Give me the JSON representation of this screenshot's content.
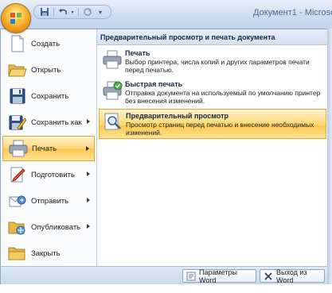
{
  "window": {
    "title": "Документ1 - Microsof"
  },
  "quick_access": {
    "items": [
      {
        "icon": "save-icon"
      },
      {
        "icon": "undo-icon"
      },
      {
        "icon": "redo-icon"
      },
      {
        "icon": "customize-qat-icon"
      }
    ]
  },
  "office_button": {
    "icon": "office-logo-icon"
  },
  "menu": {
    "items": [
      {
        "label": "Создать",
        "icon": "new-document-icon",
        "submenu": false
      },
      {
        "label": "Открыть",
        "icon": "open-folder-icon",
        "submenu": false
      },
      {
        "label": "Сохранить",
        "icon": "save-icon",
        "submenu": false
      },
      {
        "label": "Сохранить как",
        "icon": "save-as-icon",
        "submenu": true
      },
      {
        "label": "Печать",
        "icon": "print-icon",
        "submenu": true,
        "selected": true
      },
      {
        "label": "Подготовить",
        "icon": "prepare-icon",
        "submenu": true
      },
      {
        "label": "Отправить",
        "icon": "send-icon",
        "submenu": true
      },
      {
        "label": "Опубликовать",
        "icon": "publish-icon",
        "submenu": true
      },
      {
        "label": "Закрыть",
        "icon": "close-folder-icon",
        "submenu": false
      }
    ]
  },
  "submenu": {
    "header": "Предварительный просмотр и печать документа",
    "items": [
      {
        "title": "Печать",
        "desc": "Выбор принтера, числа копий и других параметров печати перед печатью.",
        "icon": "print-icon"
      },
      {
        "title": "Быстрая печать",
        "desc": "Отправка документа на используемый по умолчанию принтер без внесения изменений.",
        "icon": "quick-print-icon"
      },
      {
        "title": "Предварительный просмотр",
        "desc": "Просмотр страниц перед печатью и внесение необходимых изменений.",
        "icon": "print-preview-icon",
        "selected": true
      }
    ]
  },
  "bottom": {
    "options_label": "Параметры Word",
    "exit_label": "Выход из Word"
  }
}
